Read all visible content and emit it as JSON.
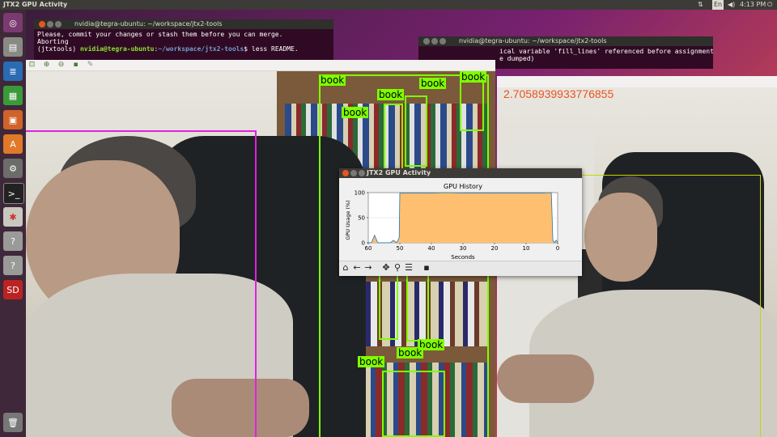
{
  "topbar": {
    "title": "JTX2 GPU Activity",
    "keyboard": "En",
    "time": "4:13 PM"
  },
  "launcher": {
    "items": [
      "ubuntu-icon",
      "files-icon",
      "writer-icon",
      "calc-icon",
      "impress-icon",
      "software-center-icon",
      "settings-icon",
      "terminal-icon",
      "tools-icon",
      "unknown-icon",
      "unknown-icon",
      "sd-card-icon"
    ],
    "trash": "trash-icon"
  },
  "term1": {
    "title": "nvidia@tegra-ubuntu: ~/workspace/jtx2-tools",
    "line1": "Please, commit your changes or stash them before you can merge.",
    "line2": "Aborting",
    "line3_env": "(jtxtools) ",
    "line3_user": "nvidia@tegra-ubuntu",
    "line3_sep": ":",
    "line3_path": "~/workspace/jtx2-tools",
    "line3_cmd": "$ less README."
  },
  "term2": {
    "title": "nvidia@tegra-ubuntu: ~/workspace/jtx2-tools",
    "line1": "ical variable 'fill_lines' referenced before assignment",
    "line2": "e dumped)"
  },
  "right_view": {
    "fps": "2.7058939933776855"
  },
  "detections": {
    "label": "book"
  },
  "gpu": {
    "window_title": "JTX2 GPU Activity",
    "toolbar": [
      "home-icon",
      "back-icon",
      "forward-icon",
      "pan-icon",
      "zoom-icon",
      "configure-subplots-icon",
      "save-icon"
    ]
  },
  "chart_data": {
    "type": "area",
    "title": "GPU History",
    "xlabel": "Seconds",
    "ylabel": "GPU Usage (%)",
    "xlim": [
      60,
      0
    ],
    "ylim": [
      0,
      100
    ],
    "xticks": [
      "60",
      "50",
      "40",
      "30",
      "20",
      "10",
      "0"
    ],
    "yticks": [
      "0",
      "50",
      "100"
    ],
    "grid": true,
    "fill_color": "#ffbf70",
    "line_color": "#1f77b4",
    "x": [
      60,
      59,
      58,
      57,
      56,
      55,
      54,
      53,
      52,
      51,
      50.2,
      50,
      49,
      45,
      40,
      35,
      30,
      25,
      20,
      15,
      10,
      5,
      2.5,
      2,
      1.5,
      1,
      0.5,
      0
    ],
    "y": [
      0,
      0,
      15,
      0,
      0,
      0,
      0,
      0,
      5,
      0,
      10,
      99,
      99,
      99,
      99,
      100,
      99,
      99,
      99,
      99,
      99,
      99,
      100,
      99,
      5,
      0,
      5,
      0
    ]
  }
}
